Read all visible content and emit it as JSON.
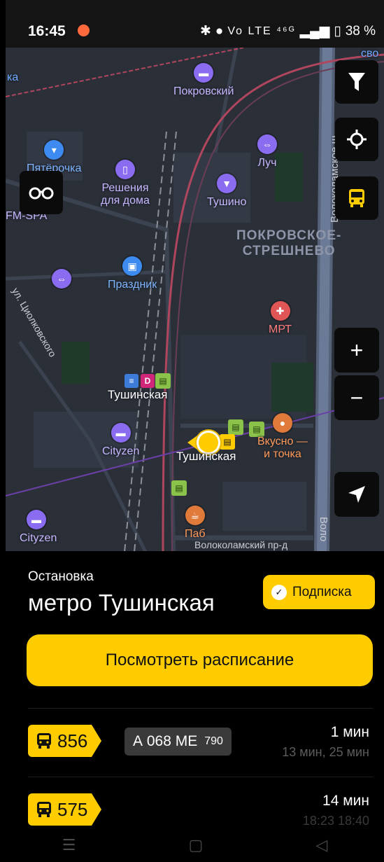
{
  "status_bar": {
    "time": "16:45",
    "network": "Vo LTE ⁴⁶ᴳ",
    "battery": "38 %"
  },
  "map": {
    "district": "ПОКРОВСКОЕ-\nСТРЕШНЕВО",
    "streets": {
      "volokolamskoe": "Волоколамское ш.",
      "tsiolkovskogo": "ул. Циолковского",
      "volokolamsky_pr": "Волоколамский пр-д",
      "volo_short": "Воло"
    },
    "pois": {
      "pokrovsky": "Покровский",
      "pyaterochka": "Пятёрочка",
      "reshenia": "Решения\nдля дома",
      "luch": "Луч",
      "tushino": "Тушино",
      "fm_spa": "FM-SPA",
      "prazdnik": "Праздник",
      "mrt": "МРТ",
      "tushinskaya_metro": "Тушинская",
      "cityzen_1": "Cityzen",
      "tushinskaya_stop": "Тушинская",
      "vkusno": "Вкусно —\nи точка",
      "cityzen_2": "Cityzen",
      "pab": "Паб",
      "ka": "ка",
      "svo": "сво"
    },
    "metro_badges": [
      "D"
    ]
  },
  "stop_card": {
    "kicker": "Остановка",
    "title": "метро Тушинская",
    "subscribe_label": "Подписка",
    "schedule_label": "Посмотреть расписание",
    "routes": [
      {
        "number": "856",
        "plate": "А 068 МЕ",
        "region": "790",
        "eta": "1 мин",
        "next": "13 мин, 25 мин"
      },
      {
        "number": "575",
        "plate": "",
        "region": "",
        "eta": "14 мин",
        "next": "18:23 18:40"
      }
    ]
  },
  "colors": {
    "accent": "#ffcc00",
    "stop_green": "#8bc34a"
  }
}
